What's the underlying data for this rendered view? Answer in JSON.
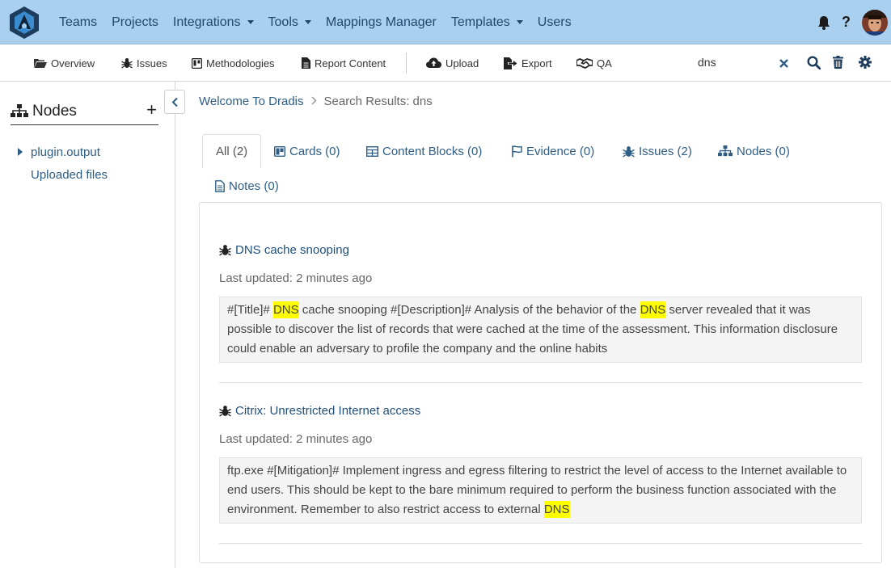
{
  "topnav": {
    "items": [
      {
        "label": "Teams",
        "dropdown": false
      },
      {
        "label": "Projects",
        "dropdown": false
      },
      {
        "label": "Integrations",
        "dropdown": true
      },
      {
        "label": "Tools",
        "dropdown": true
      },
      {
        "label": "Mappings Manager",
        "dropdown": false
      },
      {
        "label": "Templates",
        "dropdown": true
      },
      {
        "label": "Users",
        "dropdown": false
      }
    ],
    "help_label": "?"
  },
  "toolbar": {
    "overview": "Overview",
    "issues": "Issues",
    "methodologies": "Methodologies",
    "report_content": "Report Content",
    "upload": "Upload",
    "export": "Export",
    "qa": "QA",
    "search_value": "dns"
  },
  "sidebar": {
    "title": "Nodes",
    "add": "+",
    "items": [
      "plugin.output",
      "Uploaded files"
    ]
  },
  "breadcrumb": {
    "home": "Welcome To Dradis",
    "current": "Search Results: dns"
  },
  "tabs": [
    {
      "label": "All (2)",
      "icon": "none"
    },
    {
      "label": "Cards (0)",
      "icon": "card-icon"
    },
    {
      "label": "Content Blocks (0)",
      "icon": "table-icon"
    },
    {
      "label": "Evidence (0)",
      "icon": "flag-icon"
    },
    {
      "label": "Issues (2)",
      "icon": "bug-icon"
    },
    {
      "label": "Nodes (0)",
      "icon": "sitemap-icon"
    },
    {
      "label": "Notes (0)",
      "icon": "file-icon"
    }
  ],
  "results": [
    {
      "title": "DNS cache snooping",
      "updated": "Last updated: 2 minutes ago",
      "snippet": [
        {
          "t": "#[Title]# ",
          "hl": false
        },
        {
          "t": "DNS",
          "hl": true
        },
        {
          "t": " cache snooping #[Description]# Analysis of the behavior of the ",
          "hl": false
        },
        {
          "t": "DNS",
          "hl": true
        },
        {
          "t": " server revealed that it was possible to discover the list of records that were cached at the time of the assessment. This information disclosure could enable an adversary to profile the company and the online habits",
          "hl": false
        }
      ]
    },
    {
      "title": "Citrix: Unrestricted Internet access",
      "updated": "Last updated: 2 minutes ago",
      "snippet": [
        {
          "t": "ftp.exe #[Mitigation]# Implement ingress and egress filtering to restrict the level of access to the Internet available to end users. This should be kept to the bare minimum required to perform the business function associated with the environment. Remember to also restrict access to external ",
          "hl": false
        },
        {
          "t": "DNS",
          "hl": true
        }
      ]
    }
  ],
  "colors": {
    "navbar_bg": "#a9d0ee",
    "link": "#2d5d85",
    "highlight": "#ffff00"
  }
}
